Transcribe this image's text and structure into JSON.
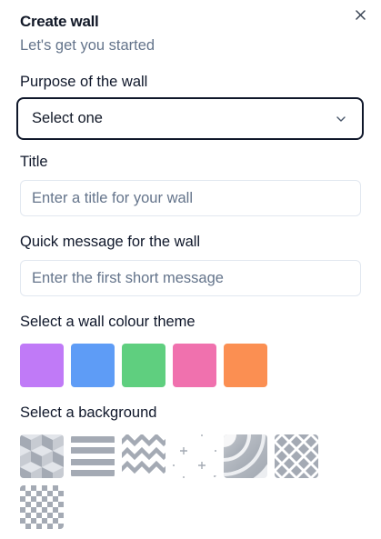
{
  "header": {
    "title": "Create wall",
    "subtitle": "Let's get you started"
  },
  "form": {
    "purpose_label": "Purpose of the wall",
    "purpose_value": "Select one",
    "title_label": "Title",
    "title_placeholder": "Enter a title for your wall",
    "message_label": "Quick message for the wall",
    "message_placeholder": "Enter the first short message",
    "colour_label": "Select a wall colour theme",
    "background_label": "Select a background"
  },
  "colour_themes": [
    "#c07af7",
    "#5e9cf6",
    "#5fcf7f",
    "#f071ae",
    "#fb8f52"
  ],
  "backgrounds": [
    "cubes-pattern",
    "horizontal-stripes-pattern",
    "zigzag-pattern",
    "plus-signs-pattern",
    "concentric-arcs-pattern",
    "diamonds-pattern",
    "checkerboard-pattern"
  ],
  "icons": {
    "close": "close-icon",
    "dropdown": "chevron-down-icon"
  }
}
